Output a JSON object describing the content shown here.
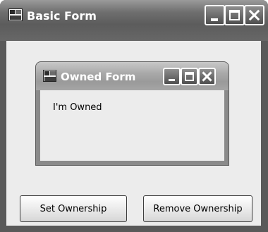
{
  "main_window": {
    "title": "Basic Form",
    "buttons": {
      "set_ownership": "Set Ownership",
      "remove_ownership": "Remove Ownership"
    }
  },
  "owned_window": {
    "title": "Owned Form",
    "label": "I'm Owned"
  },
  "icons": [
    "app-icon",
    "minimize-icon",
    "maximize-icon",
    "close-icon"
  ],
  "colors": {
    "titlebar": "#5c5c5c",
    "owned_titlebar": "#a9a9a9",
    "client_bg": "#ececec",
    "title_text": "#ffffff"
  }
}
